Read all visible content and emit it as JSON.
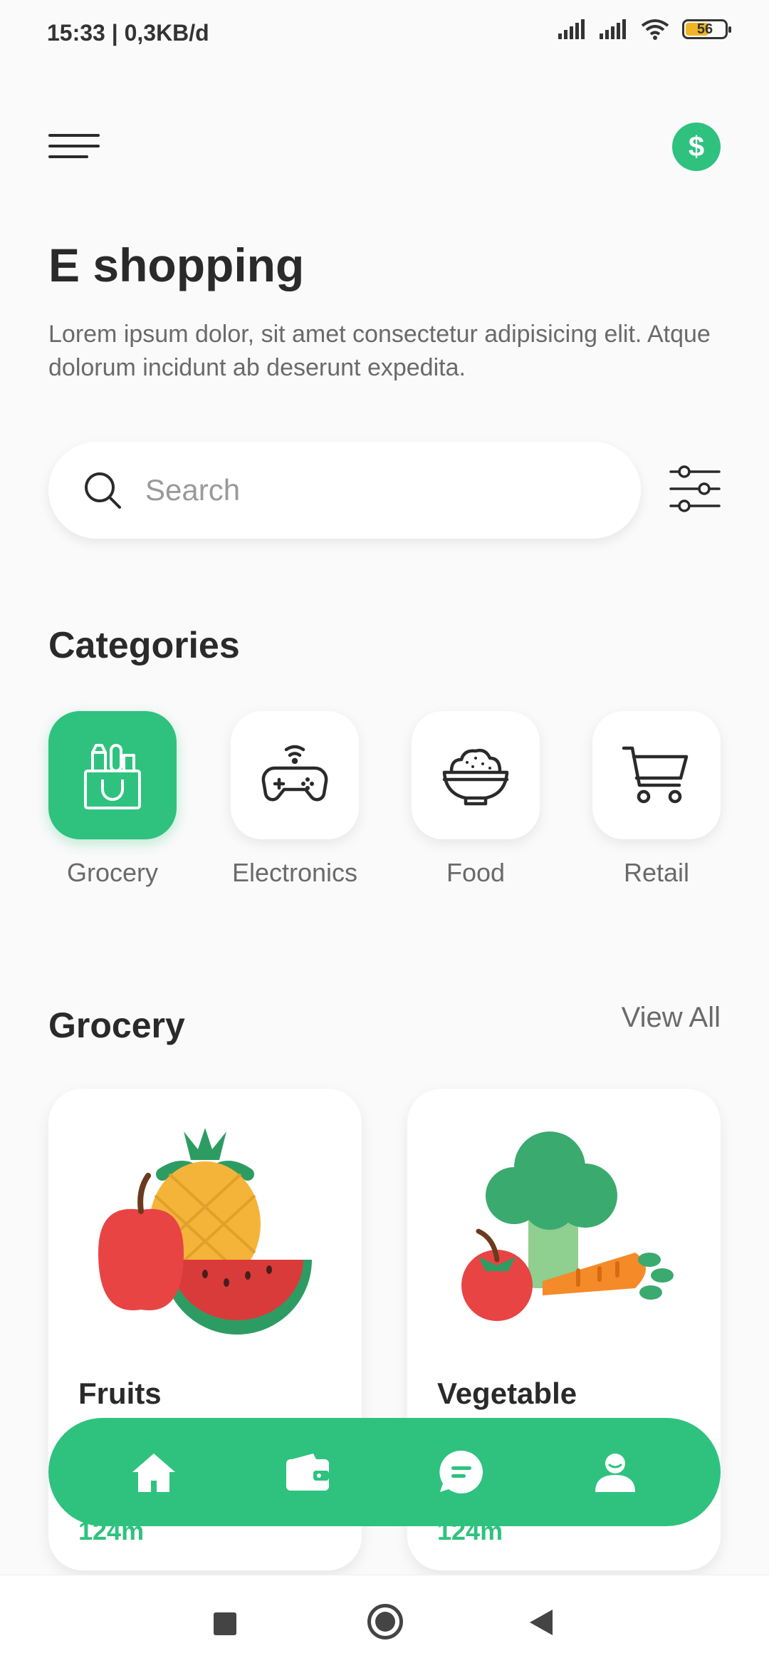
{
  "status_bar": {
    "time_text": "15:33 | 0,3KB/d",
    "battery_level": "56"
  },
  "header": {
    "menu_icon": "hamburger-icon",
    "currency_icon": "dollar-icon",
    "currency_symbol": "$"
  },
  "hero": {
    "title": "E shopping",
    "subtitle": "Lorem ipsum dolor, sit amet consectetur adipisicing elit. Atque dolorum incidunt ab deserunt expedita."
  },
  "search": {
    "placeholder": "Search",
    "value": ""
  },
  "categories": {
    "title": "Categories",
    "items": [
      {
        "label": "Grocery",
        "icon": "grocery-bag-icon",
        "active": true
      },
      {
        "label": "Electronics",
        "icon": "gamepad-icon",
        "active": false
      },
      {
        "label": "Food",
        "icon": "rice-bowl-icon",
        "active": false
      },
      {
        "label": "Retail",
        "icon": "cart-icon",
        "active": false
      }
    ]
  },
  "grocery": {
    "title": "Grocery",
    "view_all_label": "View All",
    "products": [
      {
        "name": "Fruits",
        "distance": "124m",
        "icon": "fruits-illustration"
      },
      {
        "name": "Vegetable",
        "distance": "124m",
        "icon": "vegetables-illustration"
      }
    ]
  },
  "bottom_nav": {
    "items": [
      {
        "icon": "home-icon"
      },
      {
        "icon": "wallet-icon"
      },
      {
        "icon": "chat-icon"
      },
      {
        "icon": "profile-icon"
      }
    ]
  },
  "colors": {
    "accent": "#2ec27e",
    "background": "#fafafa",
    "text_primary": "#2a2a2a",
    "text_secondary": "#6a6a6a"
  }
}
